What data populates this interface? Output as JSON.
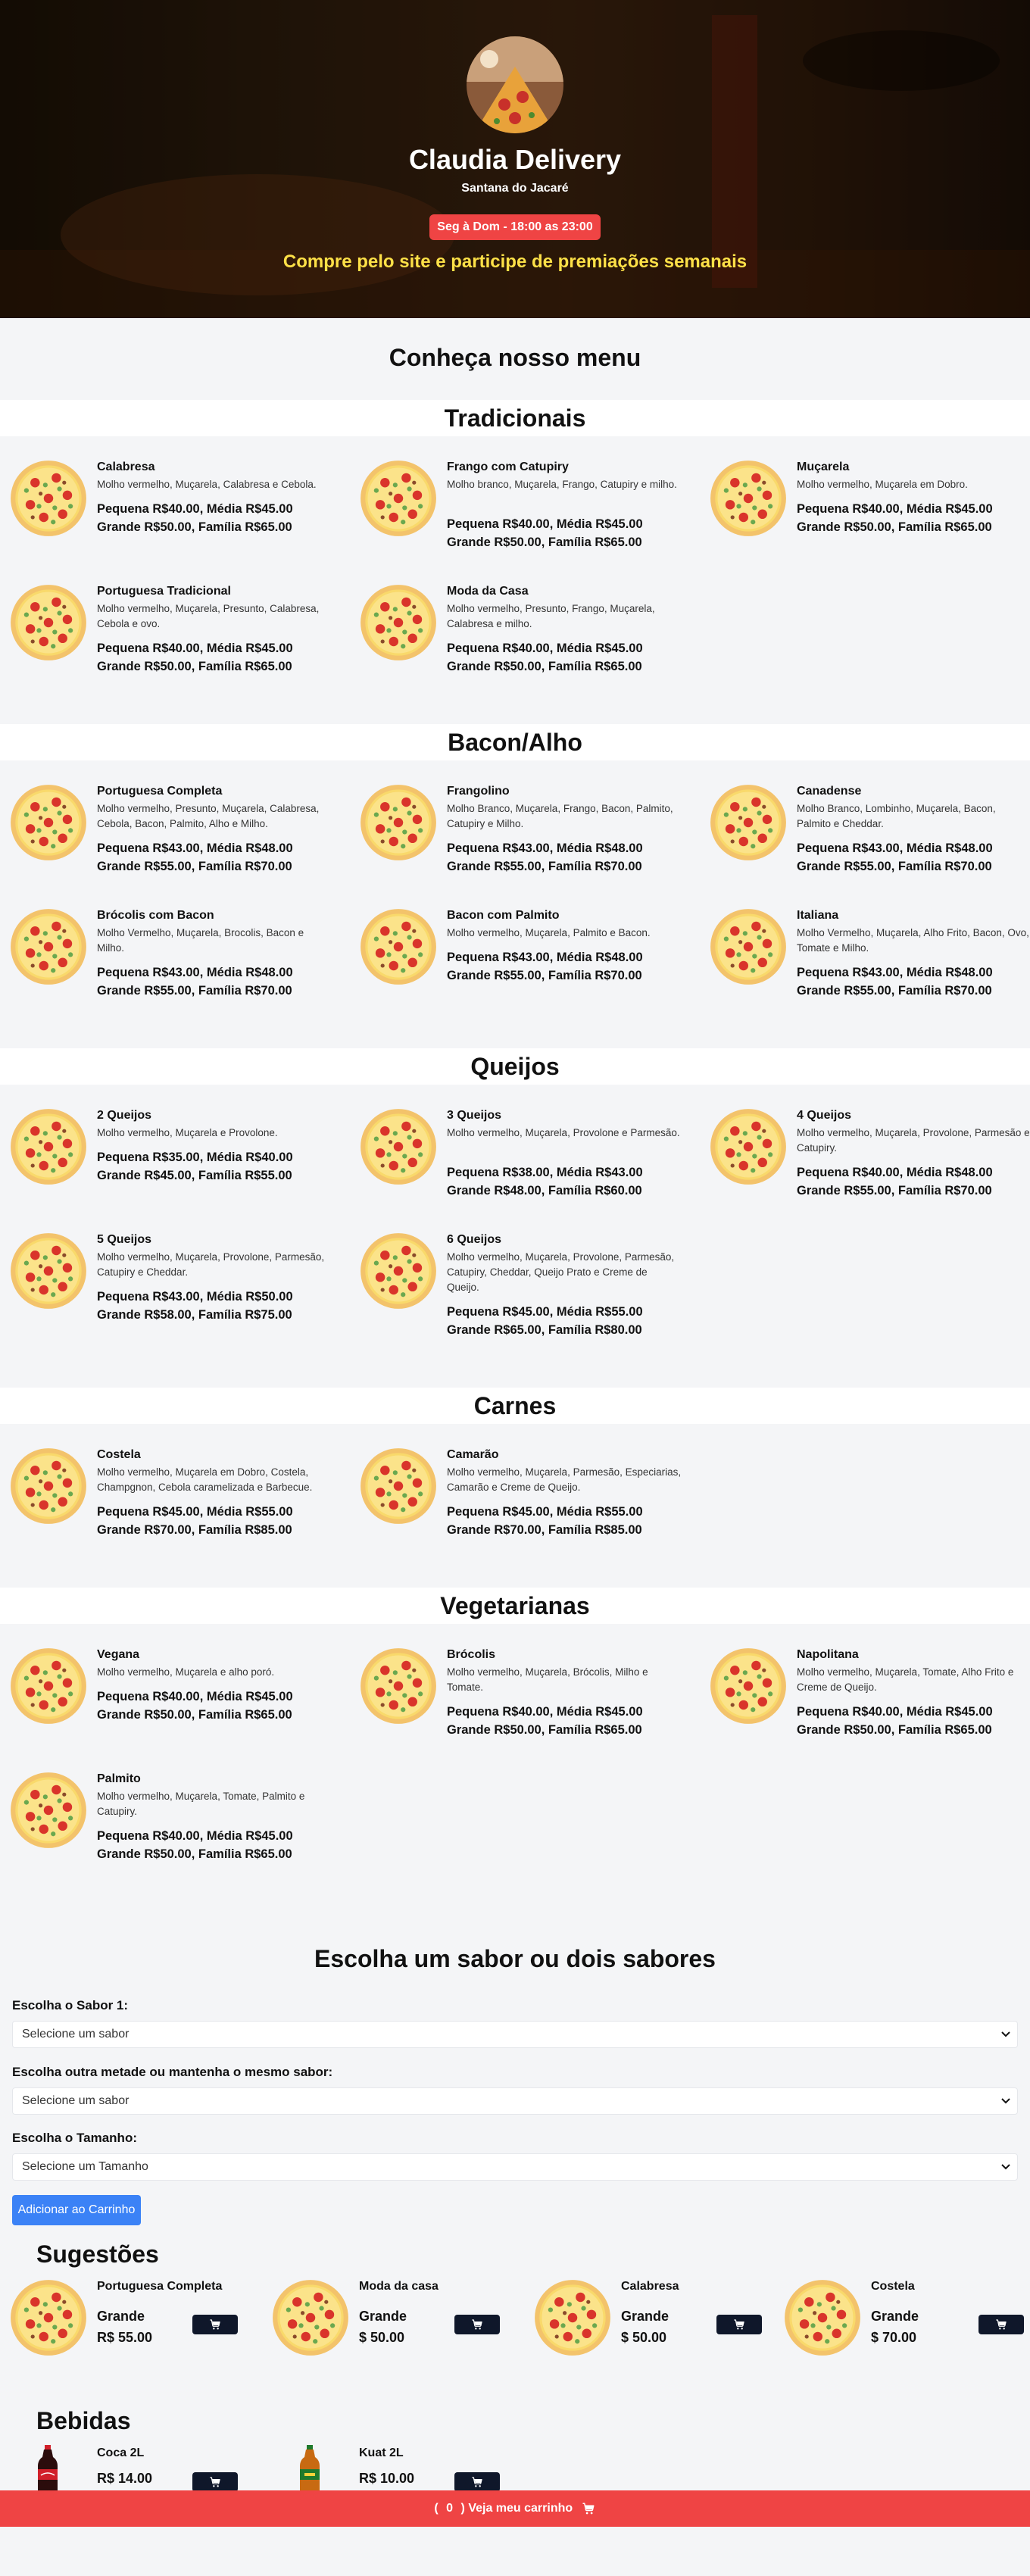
{
  "header": {
    "title": "Claudia Delivery",
    "city": "Santana do Jacaré",
    "hours": "Seg à Dom - 18:00 as 23:00",
    "promo": "Compre pelo site e participe de premiações semanais"
  },
  "menu_title": "Conheça nosso menu",
  "categories": [
    {
      "name": "Tradicionais",
      "items": [
        {
          "name": "Calabresa",
          "desc": "Molho vermelho, Muçarela, Calabresa e Cebola.",
          "p1": "Pequena R$40.00, Média R$45.00",
          "p2": "Grande R$50.00, Família R$65.00"
        },
        {
          "name": "Frango com Catupiry",
          "desc": "Molho branco, Muçarela, Frango, Catupiry e milho.",
          "p1": "Pequena R$40.00, Média R$45.00",
          "p2": "Grande R$50.00, Família R$65.00"
        },
        {
          "name": "Muçarela",
          "desc": "Molho vermelho, Muçarela em Dobro.",
          "p1": "Pequena R$40.00, Média R$45.00",
          "p2": "Grande R$50.00, Família R$65.00"
        },
        {
          "name": "Portuguesa Tradicional",
          "desc": "Molho vermelho, Muçarela, Presunto, Calabresa, Cebola e ovo.",
          "p1": "Pequena R$40.00, Média R$45.00",
          "p2": "Grande R$50.00, Família R$65.00"
        },
        {
          "name": "Moda da Casa",
          "desc": "Molho vermelho, Presunto, Frango, Muçarela, Calabresa e milho.",
          "p1": "Pequena R$40.00, Média R$45.00",
          "p2": "Grande R$50.00, Família R$65.00"
        }
      ]
    },
    {
      "name": "Bacon/Alho",
      "items": [
        {
          "name": "Portuguesa Completa",
          "desc": "Molho vermelho, Presunto, Muçarela, Calabresa, Cebola, Bacon, Palmito, Alho e Milho.",
          "p1": "Pequena R$43.00, Média R$48.00",
          "p2": "Grande R$55.00, Família R$70.00"
        },
        {
          "name": "Frangolino",
          "desc": "Molho Branco, Muçarela, Frango, Bacon, Palmito, Catupiry e Milho.",
          "p1": "Pequena R$43.00, Média R$48.00",
          "p2": "Grande R$55.00, Família R$70.00"
        },
        {
          "name": "Canadense",
          "desc": "Molho Branco, Lombinho, Muçarela, Bacon, Palmito e Cheddar.",
          "p1": "Pequena R$43.00, Média R$48.00",
          "p2": "Grande R$55.00, Família R$70.00"
        },
        {
          "name": "Brócolis com Bacon",
          "desc": "Molho Vermelho, Muçarela, Brocolis, Bacon e Milho.",
          "p1": "Pequena R$43.00, Média R$48.00",
          "p2": "Grande R$55.00, Família R$70.00"
        },
        {
          "name": "Bacon com Palmito",
          "desc": "Molho vermelho, Muçarela, Palmito e Bacon.",
          "p1": "Pequena R$43.00, Média R$48.00",
          "p2": "Grande R$55.00, Família R$70.00"
        },
        {
          "name": "Italiana",
          "desc": "Molho Vermelho, Muçarela, Alho Frito, Bacon, Ovo, Tomate e Milho.",
          "p1": "Pequena R$43.00, Média R$48.00",
          "p2": "Grande R$55.00, Família R$70.00"
        }
      ]
    },
    {
      "name": "Queijos",
      "items": [
        {
          "name": "2 Queijos",
          "desc": "Molho vermelho, Muçarela e Provolone.",
          "p1": "Pequena R$35.00, Média R$40.00",
          "p2": "Grande R$45.00, Família R$55.00"
        },
        {
          "name": "3 Queijos",
          "desc": "Molho vermelho, Muçarela, Provolone e Parmesão.",
          "p1": "Pequena R$38.00, Média R$43.00",
          "p2": "Grande R$48.00, Família R$60.00"
        },
        {
          "name": "4 Queijos",
          "desc": "Molho vermelho, Muçarela, Provolone, Parmesão e Catupiry.",
          "p1": "Pequena R$40.00, Média R$48.00",
          "p2": "Grande R$55.00, Família R$70.00"
        },
        {
          "name": "5 Queijos",
          "desc": "Molho vermelho, Muçarela, Provolone, Parmesão, Catupiry e Cheddar.",
          "p1": "Pequena R$43.00, Média R$50.00",
          "p2": "Grande R$58.00, Família R$75.00"
        },
        {
          "name": "6 Queijos",
          "desc": "Molho vermelho, Muçarela, Provolone, Parmesão, Catupiry, Cheddar, Queijo Prato e Creme de Queijo.",
          "p1": "Pequena R$45.00, Média R$55.00",
          "p2": "Grande R$65.00, Família R$80.00"
        }
      ]
    },
    {
      "name": "Carnes",
      "items": [
        {
          "name": "Costela",
          "desc": "Molho vermelho, Muçarela em Dobro, Costela, Champgnon, Cebola caramelizada e Barbecue.",
          "p1": "Pequena R$45.00, Média R$55.00",
          "p2": "Grande R$70.00, Família R$85.00"
        },
        {
          "name": "Camarão",
          "desc": "Molho vermelho, Muçarela, Parmesão, Especiarias, Camarão e Creme de Queijo.",
          "p1": "Pequena R$45.00, Média R$55.00",
          "p2": "Grande R$70.00, Família R$85.00"
        }
      ]
    },
    {
      "name": "Vegetarianas",
      "items": [
        {
          "name": "Vegana",
          "desc": "Molho vermelho, Muçarela e alho poró.",
          "p1": "Pequena R$40.00, Média R$45.00",
          "p2": "Grande R$50.00, Família R$65.00"
        },
        {
          "name": "Brócolis",
          "desc": "Molho vermelho, Muçarela, Brócolis, Milho e Tomate.",
          "p1": "Pequena R$40.00, Média R$45.00",
          "p2": "Grande R$50.00, Família R$65.00"
        },
        {
          "name": "Napolitana",
          "desc": "Molho vermelho, Muçarela, Tomate, Alho Frito e Creme de Queijo.",
          "p1": "Pequena R$40.00, Média R$45.00",
          "p2": "Grande R$50.00, Família R$65.00"
        },
        {
          "name": "Palmito",
          "desc": "Molho vermelho, Muçarela, Tomate, Palmito e Catupiry.",
          "p1": "Pequena R$40.00, Média R$45.00",
          "p2": "Grande R$50.00, Família R$65.00"
        }
      ]
    }
  ],
  "order": {
    "title": "Escolha um sabor ou dois sabores",
    "flavor1_label": "Escolha o Sabor 1:",
    "flavor1_value": "Selecione um sabor",
    "flavor2_label": "Escolha outra metade ou mantenha o mesmo sabor:",
    "flavor2_value": "Selecione um sabor",
    "size_label": "Escolha o Tamanho:",
    "size_value": "Selecione um Tamanho",
    "add_button": "Adicionar ao Carrinho"
  },
  "suggestions": {
    "title": "Sugestões",
    "items": [
      {
        "name": "Portuguesa Completa",
        "size": "Grande",
        "price": "R$ 55.00"
      },
      {
        "name": "Moda da casa",
        "size": "Grande",
        "price": "$ 50.00"
      },
      {
        "name": "Calabresa",
        "size": "Grande",
        "price": "$ 50.00"
      },
      {
        "name": "Costela",
        "size": "Grande",
        "price": "$ 70.00"
      }
    ]
  },
  "drinks": {
    "title": "Bebidas",
    "items": [
      {
        "name": "Coca 2L",
        "price": "R$ 14.00"
      },
      {
        "name": "Kuat 2L",
        "price": "R$ 10.00"
      }
    ]
  },
  "cart": {
    "open": "(",
    "count": "0",
    "close": ")",
    "label": "Veja meu carrinho"
  },
  "icons": {
    "cart": "shopping-cart-icon",
    "pizza": "pizza-icon",
    "chevron": "chevron-down-icon"
  },
  "colors": {
    "accent_red": "#ef4444",
    "promo_yellow": "#fde047",
    "button_blue": "#3b82f6",
    "cart_button": "#0f172a"
  }
}
